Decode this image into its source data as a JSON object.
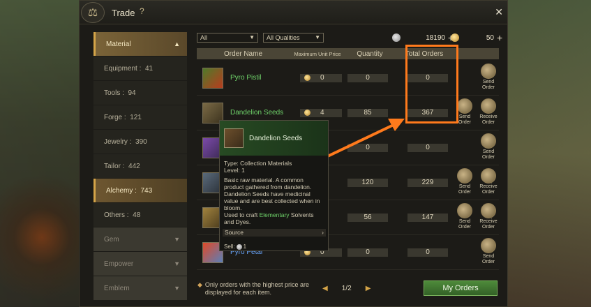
{
  "window": {
    "title": "Trade"
  },
  "sidebar": {
    "items": [
      {
        "label": "Material",
        "count": ""
      },
      {
        "label": "Equipment",
        "count": "41"
      },
      {
        "label": "Tools",
        "count": "94"
      },
      {
        "label": "Forge",
        "count": "121"
      },
      {
        "label": "Jewelry",
        "count": "390"
      },
      {
        "label": "Tailor",
        "count": "442"
      },
      {
        "label": "Alchemy",
        "count": "743"
      },
      {
        "label": "Others",
        "count": "48"
      },
      {
        "label": "Gem",
        "count": ""
      },
      {
        "label": "Empower",
        "count": ""
      },
      {
        "label": "Emblem",
        "count": ""
      }
    ]
  },
  "filters": {
    "category": "All",
    "quality": "All Qualities"
  },
  "currency": {
    "silver": "18190",
    "gold": "50"
  },
  "table": {
    "headers": [
      "Order Name",
      "Maximum Unit Price",
      "Quantity",
      "Total Orders"
    ],
    "rows": [
      {
        "name": "Pyro Pistil",
        "price": "0",
        "qty": "0",
        "total": "0",
        "actions": [
          "Send Order"
        ]
      },
      {
        "name": "Dandelion Seeds",
        "price": "4",
        "qty": "85",
        "total": "367",
        "actions": [
          "Send Order",
          "Receive Order"
        ]
      },
      {
        "name": "",
        "price": "",
        "qty": "0",
        "total": "0",
        "actions": [
          "Send Order"
        ]
      },
      {
        "name": "",
        "price": "",
        "qty": "120",
        "total": "229",
        "actions": [
          "Send Order",
          "Receive Order"
        ]
      },
      {
        "name": "",
        "price": "",
        "qty": "56",
        "total": "147",
        "actions": [
          "Send Order",
          "Receive Order"
        ]
      },
      {
        "name": "Pyro Petal",
        "price": "0",
        "qty": "0",
        "total": "0",
        "actions": [
          "Send Order"
        ]
      }
    ]
  },
  "tooltip": {
    "name": "Dandelion Seeds",
    "type": "Type: Collection Materials",
    "level": "Level: 1",
    "desc": "Basic raw material. A common product gathered from dandelion. Dandelion Seeds have medicinal value and are best collected when in bloom.",
    "used_prefix": "Used to craft ",
    "used_link": "Elementary",
    "used_suffix": " Solvents and Dyes.",
    "source": "Source",
    "sell_label": "Sell:",
    "sell_value": "1"
  },
  "footer": {
    "note": "Only orders with the highest price are displayed for each item.",
    "page": "1/2",
    "my_orders": "My Orders"
  },
  "colors": {
    "highlight": "#ff7a1c",
    "item_green": "#6fd36a",
    "accent_gold": "#d4a448"
  }
}
